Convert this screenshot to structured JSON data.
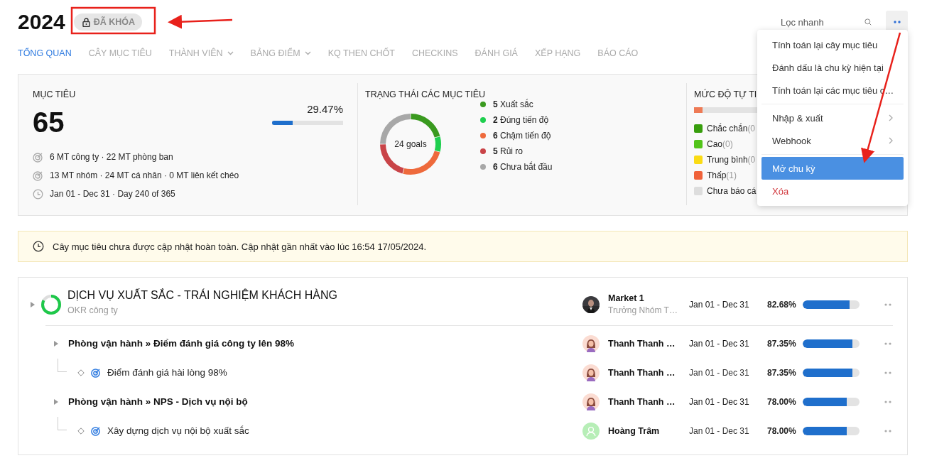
{
  "header": {
    "title": "2024",
    "badge": "ĐÃ KHÓA",
    "search": {
      "placeholder": "Lọc nhanh"
    }
  },
  "tabs": [
    {
      "label": "TỔNG QUAN",
      "selected": true,
      "has_menu": false
    },
    {
      "label": "CÂY MỤC TIÊU",
      "selected": false,
      "has_menu": false
    },
    {
      "label": "THÀNH VIÊN",
      "selected": false,
      "has_menu": true
    },
    {
      "label": "BẢNG ĐIỂM",
      "selected": false,
      "has_menu": true
    },
    {
      "label": "KQ THEN CHỐT",
      "selected": false,
      "has_menu": false
    },
    {
      "label": "CHECKINS",
      "selected": false,
      "has_menu": false
    },
    {
      "label": "ĐÁNH GIÁ",
      "selected": false,
      "has_menu": false
    },
    {
      "label": "XẾP HẠNG",
      "selected": false,
      "has_menu": false
    },
    {
      "label": "BÁO CÁO",
      "selected": false,
      "has_menu": false
    }
  ],
  "summary": {
    "goals": {
      "title": "MỤC TIÊU",
      "count": "65",
      "percent": "29.47%",
      "level": 0.2947,
      "lines": [
        {
          "kind": "target",
          "text": "6 MT công ty · 22 MT phòng ban"
        },
        {
          "kind": "target",
          "text": "13 MT nhóm · 24 MT cá nhân · 0 MT liên kết chéo"
        },
        {
          "kind": "clock",
          "text": "Jan 01 - Dec 31 · Day 240 of 365"
        }
      ]
    },
    "status": {
      "title": "TRẠNG THÁI CÁC MỤC TIÊU",
      "center_label": "24 goals",
      "legend": [
        {
          "count": "5",
          "label": "Xuất sắc",
          "color": "#3a9a1f"
        },
        {
          "count": "2",
          "label": "Đúng tiến độ",
          "color": "#1fcf4f"
        },
        {
          "count": "6",
          "label": "Chậm tiến độ",
          "color": "#ee6a3c"
        },
        {
          "count": "5",
          "label": "Rủi ro",
          "color": "#c94448"
        },
        {
          "count": "6",
          "label": "Chưa bắt đầu",
          "color": "#a8a8a8"
        }
      ]
    },
    "confidence": {
      "title": "MỨC ĐỘ TỰ TI",
      "level": 0.04,
      "legend": [
        {
          "label": "Chắc chắn",
          "count": "(0",
          "color": "#389e0d"
        },
        {
          "label": "Cao",
          "count": "(0)",
          "color": "#52c41a"
        },
        {
          "label": "Trung bình",
          "count": "(0",
          "color": "#fadb14"
        },
        {
          "label": "Thấp",
          "count": "(1)",
          "color": "#f0623a"
        },
        {
          "label": "Chưa báo cá",
          "color": "#dddddd"
        }
      ]
    }
  },
  "notice": "Cây mục tiêu chưa được cập nhật hoàn toàn. Cập nhật gần nhất vào lúc 16:54 17/05/2024.",
  "goals": [
    {
      "kind": "objective",
      "title": "DỊCH VỤ XUẤT SẮC - TRÁI NGHIỆM KHÁCH HÀNG",
      "subtitle": "OKR công ty",
      "owner": {
        "name": "Market 1",
        "role": "Trưởng Nhóm T…",
        "kind": "picture"
      },
      "dates": "Jan 01 - Dec 31",
      "percent": "82.68%",
      "level": 0.8268,
      "children": [
        {
          "kind": "objective",
          "title": "Phòng vận hành » Điểm đánh giá công ty lên 98%",
          "owner": {
            "name": "Thanh Thanh …",
            "kind": "illustration"
          },
          "dates": "Jan 01 - Dec 31",
          "percent": "87.35%",
          "level": 0.8735,
          "children": [
            {
              "kind": "key_result",
              "title": "Điểm đánh giá hài lòng 98%",
              "owner": {
                "name": "Thanh Thanh …",
                "kind": "illustration"
              },
              "dates": "Jan 01 - Dec 31",
              "percent": "87.35%",
              "level": 0.8735
            }
          ]
        },
        {
          "kind": "objective",
          "title": "Phòng vận hành » NPS - Dịch vụ nội bộ",
          "owner": {
            "name": "Thanh Thanh …",
            "kind": "illustration"
          },
          "dates": "Jan 01 - Dec 31",
          "percent": "78.00%",
          "level": 0.78,
          "children": [
            {
              "kind": "key_result",
              "title": "Xây dựng dịch vụ nội bộ xuất sắc",
              "owner": {
                "name": "Hoàng Trâm",
                "kind": "placeholder"
              },
              "dates": "Jan 01 - Dec 31",
              "percent": "78.00%",
              "level": 0.78
            }
          ]
        }
      ]
    }
  ],
  "menu": [
    {
      "label": "Tính toán lại cây mục tiêu",
      "kind": "normal",
      "selected": false
    },
    {
      "label": "Đánh dấu là chu kỳ hiện tại",
      "kind": "normal",
      "selected": false
    },
    {
      "label": "Tính toán lại các mục tiêu c…",
      "kind": "normal",
      "selected": false
    },
    {
      "label": "Nhập & xuất",
      "kind": "submenu",
      "selected": false,
      "divider_before": true
    },
    {
      "label": "Webhook",
      "kind": "submenu",
      "selected": false
    },
    {
      "label": "Mở chu kỳ",
      "kind": "normal",
      "selected": true,
      "divider_before": true
    },
    {
      "label": "Xóa",
      "kind": "danger",
      "selected": false
    }
  ]
}
